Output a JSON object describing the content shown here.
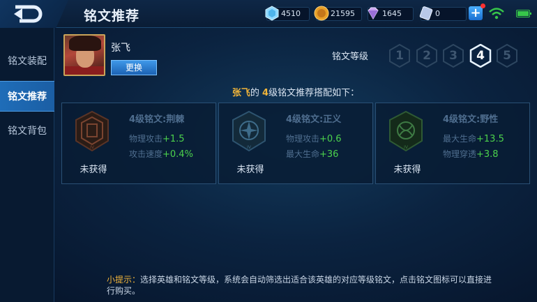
{
  "header": {
    "title": "铭文推荐"
  },
  "resources": {
    "diamond": "4510",
    "gold": "21595",
    "gem": "1645",
    "ticket": "0"
  },
  "sidebar": {
    "items": [
      {
        "label": "铭文装配"
      },
      {
        "label": "铭文推荐"
      },
      {
        "label": "铭文背包"
      }
    ]
  },
  "hero": {
    "name": "张飞",
    "change_label": "更换"
  },
  "level": {
    "label": "铭文等级",
    "options": [
      "1",
      "2",
      "3",
      "4",
      "5"
    ],
    "selected": "4"
  },
  "recommend": {
    "hero": "张飞",
    "mid1": "的 ",
    "level": "4",
    "rest": "级铭文推荐搭配如下："
  },
  "cards": [
    {
      "title": "4级铭文:荆棘",
      "color": "#8a3a26",
      "status": "未获得",
      "stats": [
        {
          "name": "物理攻击",
          "value": "+1.5"
        },
        {
          "name": "攻击速度",
          "value": "+0.4%"
        }
      ]
    },
    {
      "title": "4级铭文:正义",
      "color": "#2a6a8c",
      "status": "未获得",
      "stats": [
        {
          "name": "物理攻击",
          "value": "+0.6"
        },
        {
          "name": "最大生命",
          "value": "+36"
        }
      ]
    },
    {
      "title": "4级铭文:野性",
      "color": "#2f6a3a",
      "status": "未获得",
      "stats": [
        {
          "name": "最大生命",
          "value": "+13.5"
        },
        {
          "name": "物理穿透",
          "value": "+3.8"
        }
      ]
    }
  ],
  "tip": {
    "label": "小提示：",
    "text": "选择英雄和铭文等级，系统会自动筛选出适合该英雄的对应等级铭文，点击铭文图标可以直接进行购买。"
  }
}
